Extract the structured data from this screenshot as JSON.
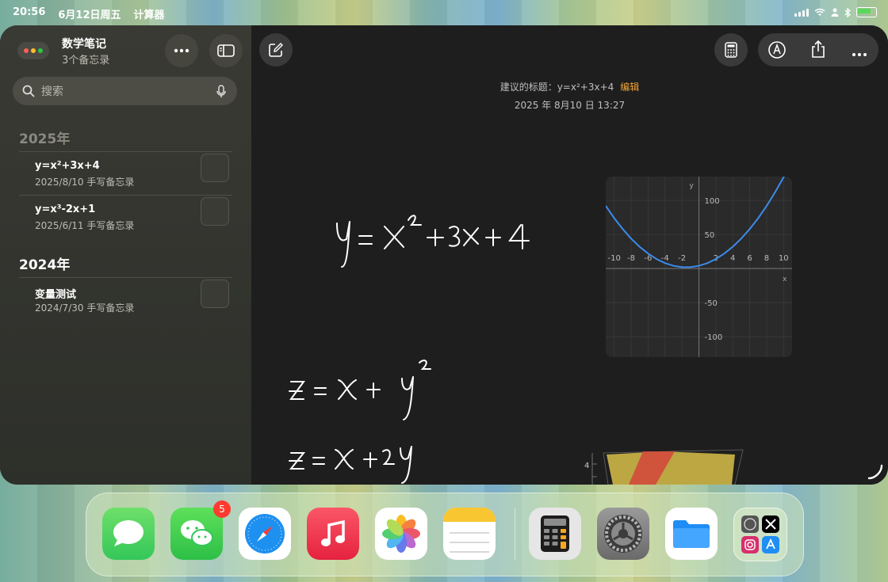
{
  "status_bar": {
    "time": "20:56",
    "date": "6月12日周五",
    "app_name": "计算器"
  },
  "sidebar": {
    "title": "数学笔记",
    "subtitle": "3个备忘录",
    "search_placeholder": "搜索",
    "sections": [
      {
        "year": "2025年",
        "notes": [
          {
            "title": "y=x²+3x+4",
            "meta": "2025/8/10  手写备忘录"
          },
          {
            "title": "y=x³-2x+1",
            "meta": "2025/6/11  手写备忘录"
          }
        ]
      },
      {
        "year": "2024年",
        "notes": [
          {
            "title": "变量测试",
            "meta": "2024/7/30  手写备忘录"
          }
        ]
      }
    ]
  },
  "note": {
    "suggested_title_label": "建议的标题：y=x²+3x+4",
    "edit_label": "编辑",
    "timestamp": "2025 年 8月10 日 13:27",
    "equations": [
      "y = x² + 3x + 4",
      "z = x + y²",
      "z = x + 2y"
    ]
  },
  "chart_data": {
    "type": "line",
    "title": "",
    "xlabel": "x",
    "ylabel": "y",
    "xlim": [
      -11,
      11
    ],
    "ylim": [
      -130,
      135
    ],
    "x_ticks": [
      "-10",
      "-8",
      "-6",
      "-4",
      "-2",
      "2",
      "4",
      "6",
      "8",
      "10"
    ],
    "y_ticks": [
      "100",
      "50",
      "-50",
      "-100"
    ],
    "grid": true,
    "series": [
      {
        "values_x": [
          -11,
          -10,
          -9,
          -8,
          -7,
          -6,
          -5,
          -4,
          -3,
          -2,
          -1,
          0,
          1,
          2,
          3,
          4,
          5,
          6,
          7,
          8,
          9,
          10,
          11
        ],
        "values_y": [
          92,
          74,
          58,
          44,
          32,
          22,
          14,
          8,
          4,
          2,
          2,
          4,
          8,
          14,
          22,
          32,
          44,
          58,
          74,
          92,
          112,
          134,
          158
        ]
      }
    ],
    "color": "#3b8beb"
  },
  "plot3d": {
    "tick": "4"
  },
  "dock": {
    "apps": [
      {
        "name": "messages",
        "badge": ""
      },
      {
        "name": "wechat",
        "badge": "5"
      },
      {
        "name": "safari",
        "badge": ""
      },
      {
        "name": "music",
        "badge": ""
      },
      {
        "name": "photos",
        "badge": ""
      },
      {
        "name": "notes",
        "badge": ""
      },
      {
        "name": "calculator",
        "badge": ""
      },
      {
        "name": "settings",
        "badge": ""
      },
      {
        "name": "files",
        "badge": ""
      },
      {
        "name": "app-folder",
        "badge": ""
      }
    ]
  }
}
